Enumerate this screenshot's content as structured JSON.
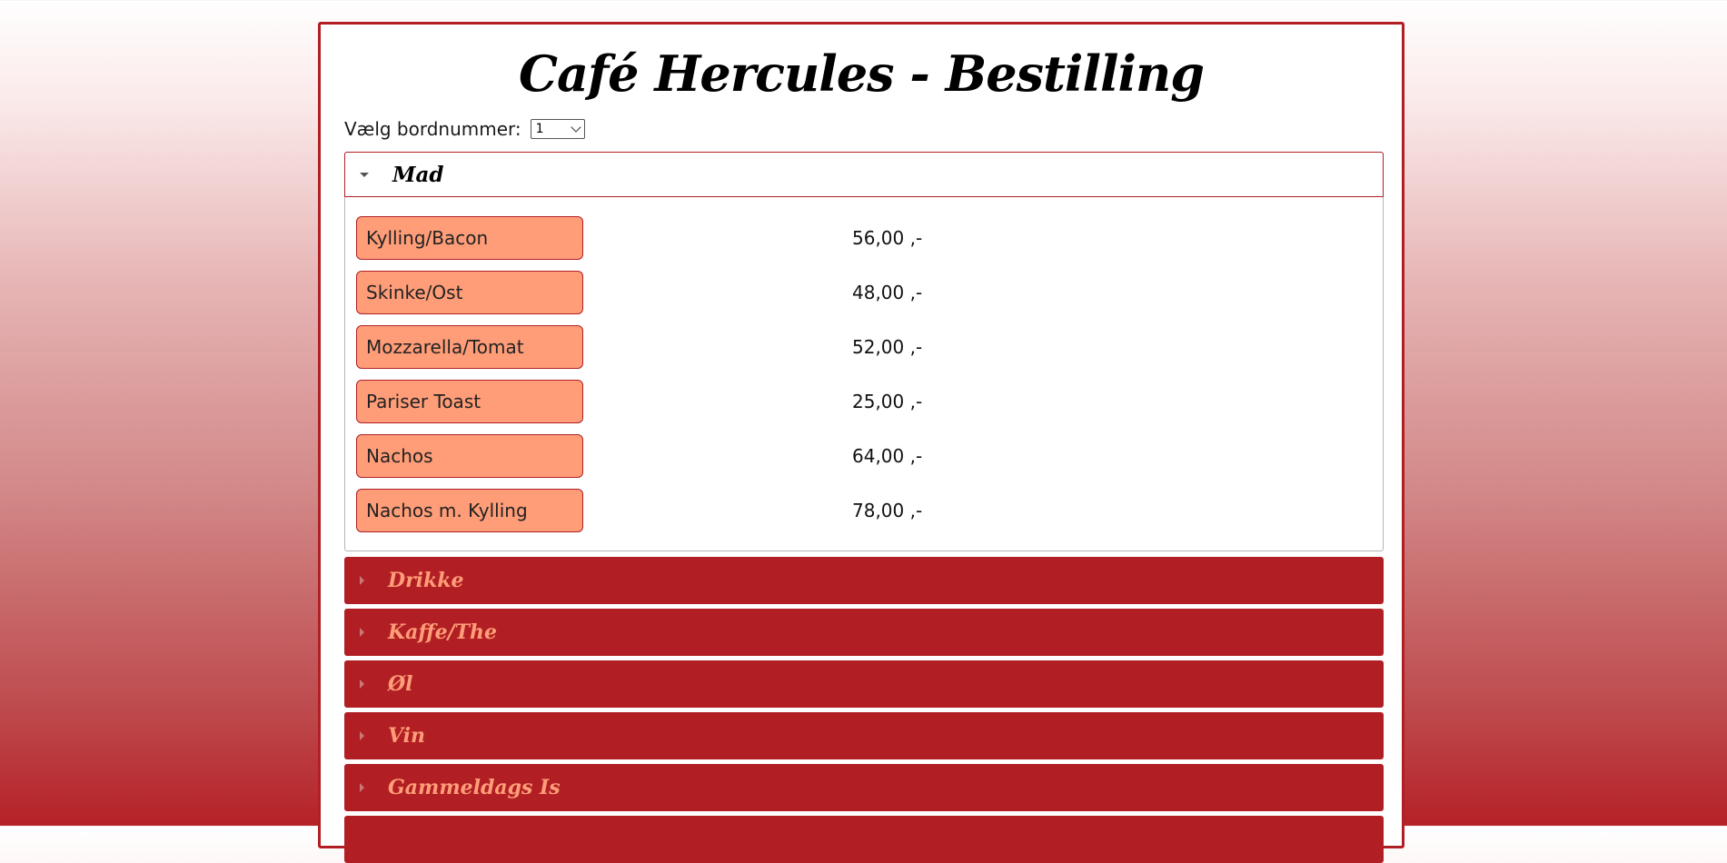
{
  "page": {
    "title": "Café Hercules - Bestilling"
  },
  "table_select": {
    "label": "Vælg bordnummer:",
    "value": "1"
  },
  "open_section": {
    "label": "Mad",
    "items": [
      {
        "name": "Kylling/Bacon",
        "price": "56,00 ,-"
      },
      {
        "name": "Skinke/Ost",
        "price": "48,00 ,-"
      },
      {
        "name": "Mozzarella/Tomat",
        "price": "52,00 ,-"
      },
      {
        "name": "Pariser Toast",
        "price": "25,00 ,-"
      },
      {
        "name": "Nachos",
        "price": "64,00 ,-"
      },
      {
        "name": "Nachos m. Kylling",
        "price": "78,00 ,-"
      }
    ]
  },
  "closed_sections": [
    {
      "label": "Drikke"
    },
    {
      "label": "Kaffe/The"
    },
    {
      "label": "Øl"
    },
    {
      "label": "Vin"
    },
    {
      "label": "Gammeldags Is"
    },
    {
      "label": ""
    }
  ],
  "colors": {
    "accent": "#b11f24",
    "button": "#ff9d78"
  }
}
